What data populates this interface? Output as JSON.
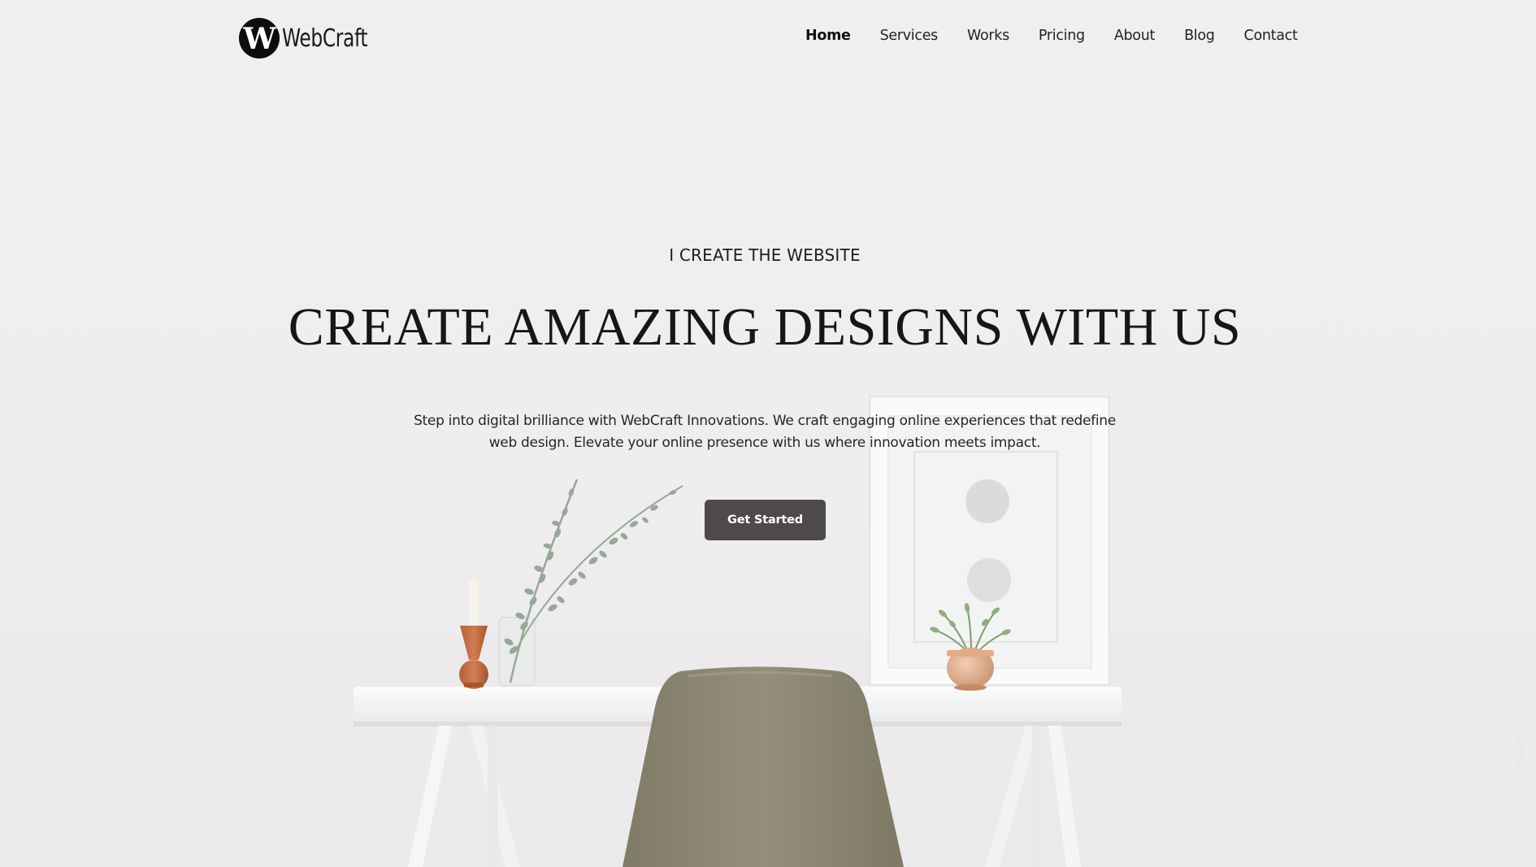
{
  "brand": {
    "logo_letter": "W",
    "logo_text": "WebCraft"
  },
  "nav": {
    "items": [
      {
        "label": "Home",
        "active": true
      },
      {
        "label": "Services",
        "active": false
      },
      {
        "label": "Works",
        "active": false
      },
      {
        "label": "Pricing",
        "active": false
      },
      {
        "label": "About",
        "active": false
      },
      {
        "label": "Blog",
        "active": false
      },
      {
        "label": "Contact",
        "active": false
      }
    ]
  },
  "hero": {
    "eyebrow": "I CREATE THE WEBSITE",
    "headline": "CREATE AMAZING DESIGNS WITH US",
    "description": "Step into digital brilliance with WebCraft Innovations. We craft engaging online experiences that redefine web design. Elevate your online presence with us where innovation meets impact.",
    "cta_label": "Get Started"
  },
  "colors": {
    "background": "#efeeef",
    "text": "#161616",
    "button": "#4e4a4a",
    "button_text": "#ffffff",
    "chair": "#8e8a75"
  }
}
